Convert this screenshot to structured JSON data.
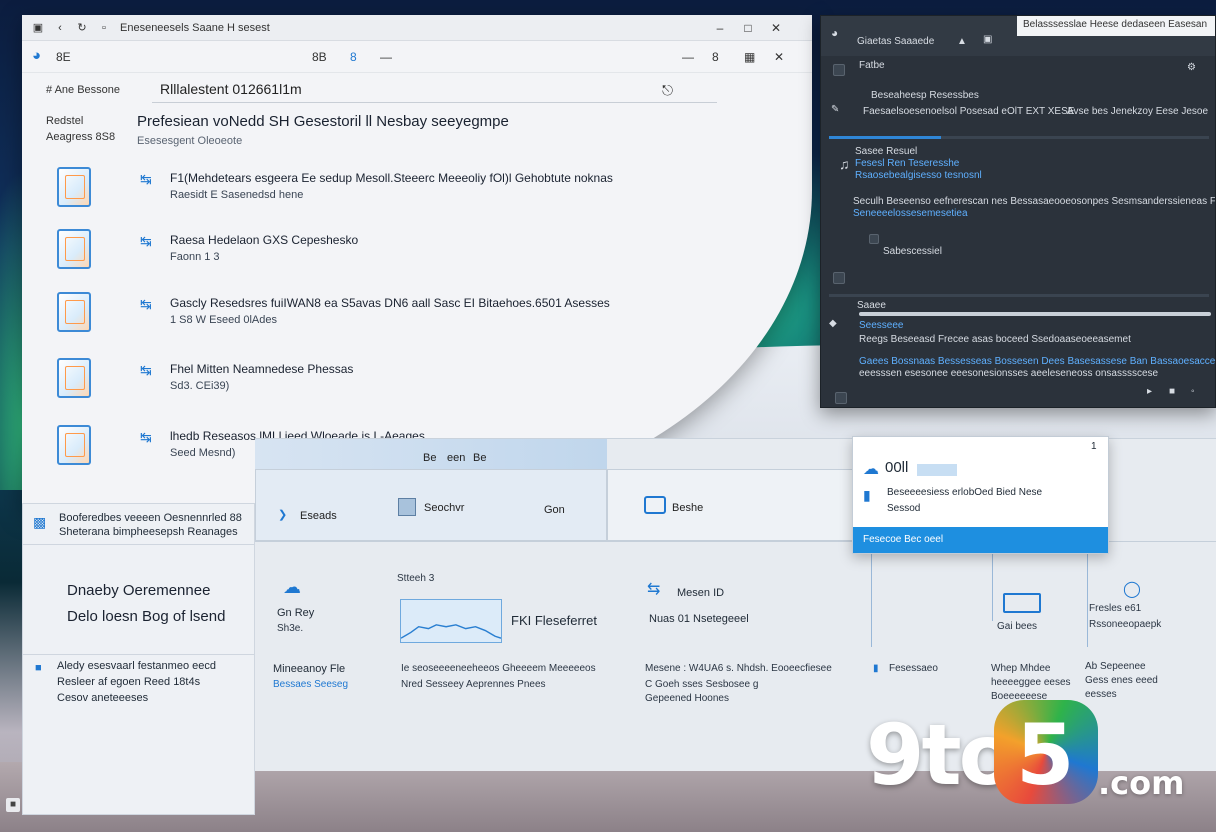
{
  "main_window": {
    "title": "Eneseneesels Saane H sesest",
    "toolbar": {
      "item_a": "8E",
      "item_b": "8B",
      "item_c": "8"
    },
    "nav_label": "# Ane Bessone",
    "address": "Rlllalestent 012661l1m",
    "side_labels": [
      "Redstel",
      "Aeagress 8S8"
    ],
    "heading": "Prefesiean voNedd SH Gesestoril ll Nesbay seeyegmpe",
    "subheading": "Esesesgent Oleoeote",
    "items": [
      {
        "title": "F1(Mehdetears esgeera Ee sedup Mesoll.Steeerc Meeeoliy fOl)l Gehobtute noknas",
        "sub": "Raesidt E Sasenedsd hene"
      },
      {
        "title": "Raesa Hedelaon GXS Cepeshesko",
        "sub": "Faonn 1 3"
      },
      {
        "title": "Gascly Resedsres fuiIWAN8 ea S5avas DN6 aall Sasc EI Bitaehoes.6501 Asesses",
        "sub": "1 S8 W Eseed 0lAdes"
      },
      {
        "title": "Fhel Mitten Neamnedese Phessas",
        "sub": "Sd3. CEi39)"
      },
      {
        "title": "lhedb Reseasos lMLl ieed Wloeade is L-Aeages",
        "sub": "Seed Mesnd)"
      }
    ]
  },
  "dark_panel": {
    "tab_title": "Belasssesslae Heese dedaseen Easesan",
    "header": "Giaetas Saaaede",
    "sub_header": "Fatbe",
    "row1_a": "Beseaheesp Resessbes",
    "row1_b": "Faesaelsoesenoelsol Posesad eOlT EXT XESE",
    "row1_c": "Avse bes Jenekzoy Eese Jesoe",
    "block_title": "Sasee Resuel",
    "block_lines": [
      "Fesesl Ren Teseresshe",
      "Rsaosebealgisesso tesnosnl"
    ],
    "para_a": "Seculh Beseenso eefnerescan nes Bessasaeooeosonpes Sesmsanderssieneas Fesenesees",
    "para_b": "Seneeeelossesemesetiea",
    "footer_tag": "Sabescessiel",
    "bottom_a": "Saaee",
    "bottom_b": "Seesseee",
    "bottom_c": "Reegs Beseeasd Frecee asas boceed Ssedoaaseoeeasemet",
    "bottom_d": "Gaees Bossnaas Bessesseas Bossesen Dees Basesassese Ban Bassaoesaccess",
    "bottom_e": "eeesssen esesonee eeesonesionsses aeeleseneoss onsasssscese"
  },
  "bottom_window": {
    "header_labels": [
      "Be",
      "een",
      "Be"
    ],
    "tab_1": "Eseads",
    "tab_2": "Seochvr",
    "tab_3": "Gon",
    "tab_4": "Beshe",
    "col1_title": "Gn Rey",
    "col1_sub": "Sh3e.",
    "col1_a": "Mineeanoy Fle",
    "col1_b": "Bessaes Seeseg",
    "chart_label": "Stteeh 3",
    "chart_caption": "FKI Fleseferret",
    "col2_a": "Ie seoseeeeneeheeos Gheeeem Meeeeeos",
    "col2_b": "Nred Sesseey Aeprennes Pnees",
    "col3_title": "Mesen ID",
    "col3_sub": "Nuas 01 Nsetegeeel",
    "col3_a": "Mesene : W4UA6 s. Nhdsh. Eooeecfiesee",
    "col3_b": "C Goeh sses Sesbosee g",
    "col3_c": "Gepeened Hoones",
    "col4_a": "Fesessaeo",
    "col5_icon_label": "Gai bees",
    "col5_a": "Whep Mhdee",
    "col5_b": "heeeeggee eeses",
    "col5_c": "Boeeeeeese",
    "col6_a": "Fresles e61",
    "col6_b": "Rssoneeopaepk",
    "col6_c": "Ab Sepeenee",
    "col6_d": "Gess enes eeed",
    "col6_e": "eesses"
  },
  "left_card": {
    "line_1": "Booferedbes veeeen Oesnennrled 88",
    "line_2": "Sheterana bimpheesepsh Reanages",
    "big_1": "Dnaeby Oeremennee",
    "big_2": "Delo loesn Bog of lsend",
    "p_1": "Aledy esesvaarl festanmeo eecd",
    "p_2": "Resleer af egoen Reed 18t4s",
    "p_3": "Cesov aneteeeses"
  },
  "popup": {
    "title": "00ll",
    "line_1": "Beseeeesiess erlobOed Bied Nese",
    "line_2": "Sessod",
    "bar": "Fesecoe Bec oeel",
    "close": "1"
  },
  "watermark": {
    "left": "9to",
    "mark": "5",
    "right": ".com"
  },
  "colors": {
    "accent": "#1e8fe0",
    "dark_panel": "#2b323b"
  }
}
